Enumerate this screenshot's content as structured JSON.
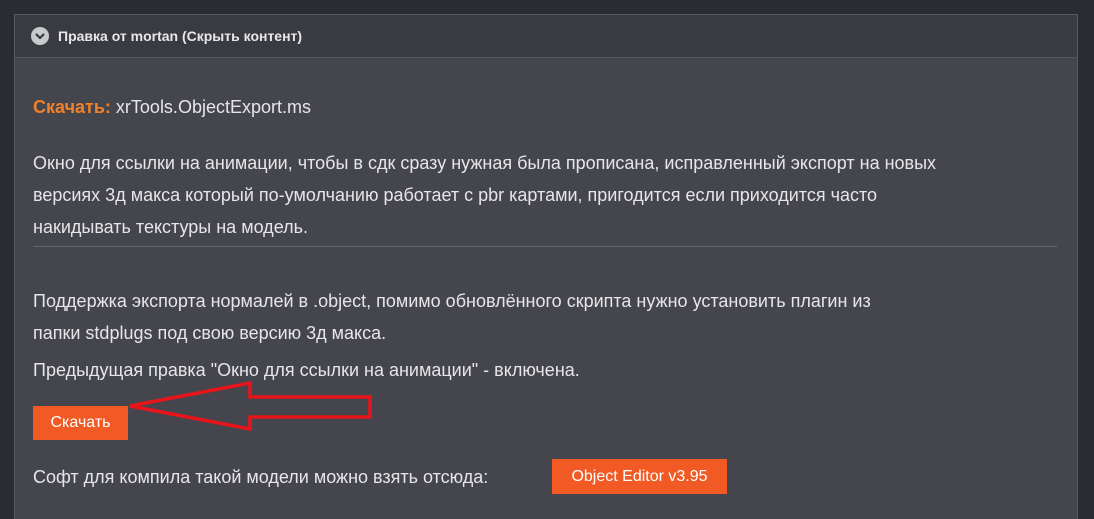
{
  "spoiler": {
    "title": "Правка от mortan (Скрыть контент)"
  },
  "download_line": {
    "label": "Скачать:",
    "filename": "xrTools.ObjectExport.ms"
  },
  "paragraph1": {
    "line1": "Окно для ссылки на анимации, чтобы в сдк сразу нужная была прописана, исправленный экспорт на новых",
    "line2": "версиях 3д макса который по-умолчанию работает с pbr картами, пригодится если приходится часто",
    "line3": "накидывать текстуры на модель."
  },
  "paragraph2": {
    "line1": "Поддержка экспорта нормалей в .object, помимо обновлённого скрипта нужно установить плагин из",
    "line2": "папки stdplugs под свою версию 3д макса."
  },
  "paragraph3": "Предыдущая правка \"Окно для ссылки на анимации\" - включена.",
  "download_button": "Скачать",
  "soft_line": {
    "text": "Софт для компила такой модели можно взять отсюда:",
    "button": "Object Editor v3.95"
  },
  "colors": {
    "accent": "#f15a24",
    "label_orange": "#f0812a",
    "arrow_red": "#e8141c",
    "panel_bg": "#45464d"
  },
  "icons": {
    "spoiler_toggle": "chevron-down-icon",
    "annotation": "red-arrow-left"
  }
}
